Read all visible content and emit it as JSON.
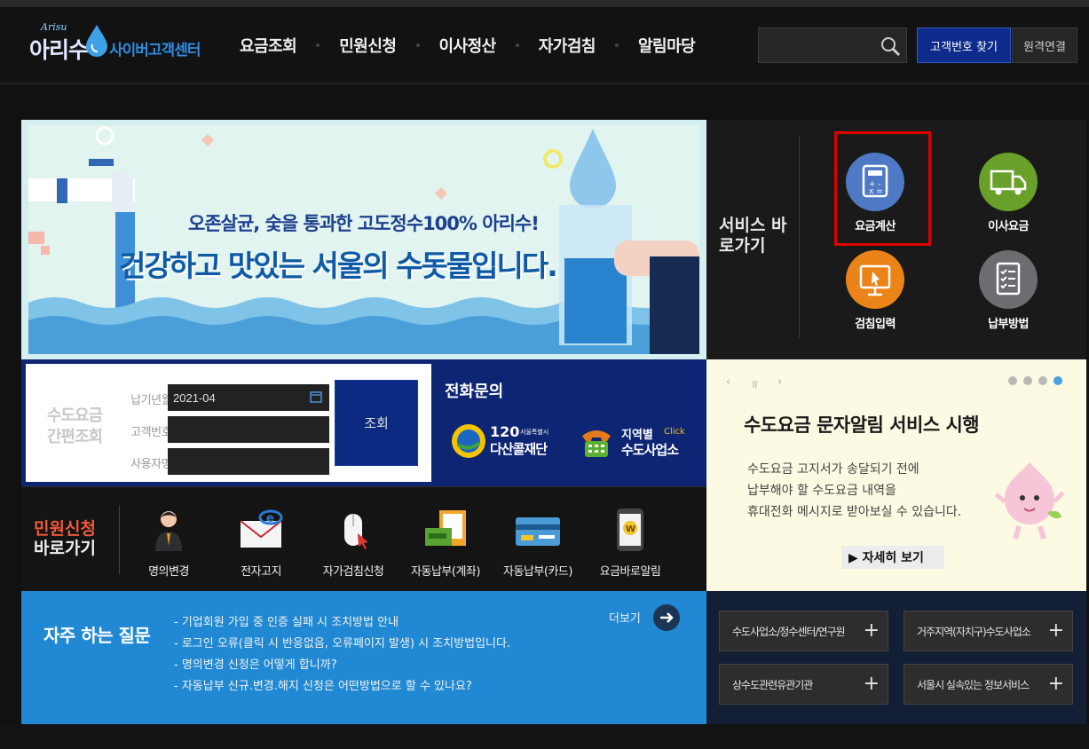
{
  "header": {
    "logo_small": "Arisu",
    "logo_main": "아리수",
    "logo_text": "사이버고객센터",
    "nav": [
      "요금조회",
      "민원신청",
      "이사정산",
      "자가검침",
      "알림마당"
    ],
    "search_placeholder": "",
    "find_button": "고객번호 찾기",
    "remote_button": "원격연결"
  },
  "banner": {
    "line1": "오존살균, 숯을 통과한 고도정수100% 아리수!",
    "line2": "건강하고 맛있는 서울의 수돗물입니다."
  },
  "services": {
    "title": "서비스 바로가기",
    "items": [
      {
        "label": "요금계산",
        "icon": "calculator-icon",
        "color": "#4f79c4"
      },
      {
        "label": "이사요금",
        "icon": "truck-icon",
        "color": "#69a02a"
      },
      {
        "label": "검침입력",
        "icon": "monitor-pointer-icon",
        "color": "#ea8419"
      },
      {
        "label": "납부방법",
        "icon": "checklist-icon",
        "color": "#6c6d70"
      }
    ]
  },
  "quick_lookup": {
    "title": "수도요금 간편조회",
    "labels": [
      "납기년월",
      "고객번호",
      "사용자명"
    ],
    "period_value": "2021-04",
    "customer_value": "",
    "user_value": "",
    "button": "조회"
  },
  "phone": {
    "title": "전화문의",
    "dasan_number": "120",
    "dasan_small": "서울특별시",
    "dasan_name": "다산콜재단",
    "region_label": "지역별",
    "region_click": "Click",
    "region_name": "수도사업소"
  },
  "notice": {
    "title": "수도요금 문자알림 서비스 시행",
    "body": [
      "수도요금 고지서가 송달되기 전에",
      "납부해야 할 수도요금 내역을",
      "휴대전화 메시지로 받아보실 수 있습니다."
    ],
    "button": "▶ 자세히 보기",
    "prev": "‹",
    "pause": "॥",
    "next": "›",
    "slides": 4,
    "active_slide": 4
  },
  "minwon": {
    "title_1": "민원신청",
    "title_2": "바로가기",
    "items": [
      {
        "label": "명의변경",
        "icon": "person-icon"
      },
      {
        "label": "전자고지",
        "icon": "email-icon"
      },
      {
        "label": "자가검침신청",
        "icon": "mouse-icon"
      },
      {
        "label": "자동납부(계좌)",
        "icon": "bankbook-icon"
      },
      {
        "label": "자동납부(카드)",
        "icon": "card-icon"
      },
      {
        "label": "요금바로알림",
        "icon": "phone-won-icon"
      }
    ]
  },
  "faq": {
    "title": "자주 하는 질문",
    "more": "더보기",
    "items": [
      "- 기업회원 가입 중 인증 실패 시 조치방법 안내",
      "- 로그인 오류(클릭 시 반응없음, 오류페이지 발생) 시 조치방법입니다.",
      "- 명의변경 신청은 어떻게 합니까?",
      "- 자동납부 신규.변경.해지 신청은 어떤방법으로 할 수 있나요?"
    ]
  },
  "links": [
    "수도사업소/정수센터/연구원",
    "거주지역(자치구)수도사업소",
    "상수도관련유관기관",
    "서울시 실속있는 정보서비스"
  ],
  "colors": {
    "highlight": "#e00000",
    "accent_blue": "#0d2573",
    "faq_blue": "#2189d3"
  }
}
